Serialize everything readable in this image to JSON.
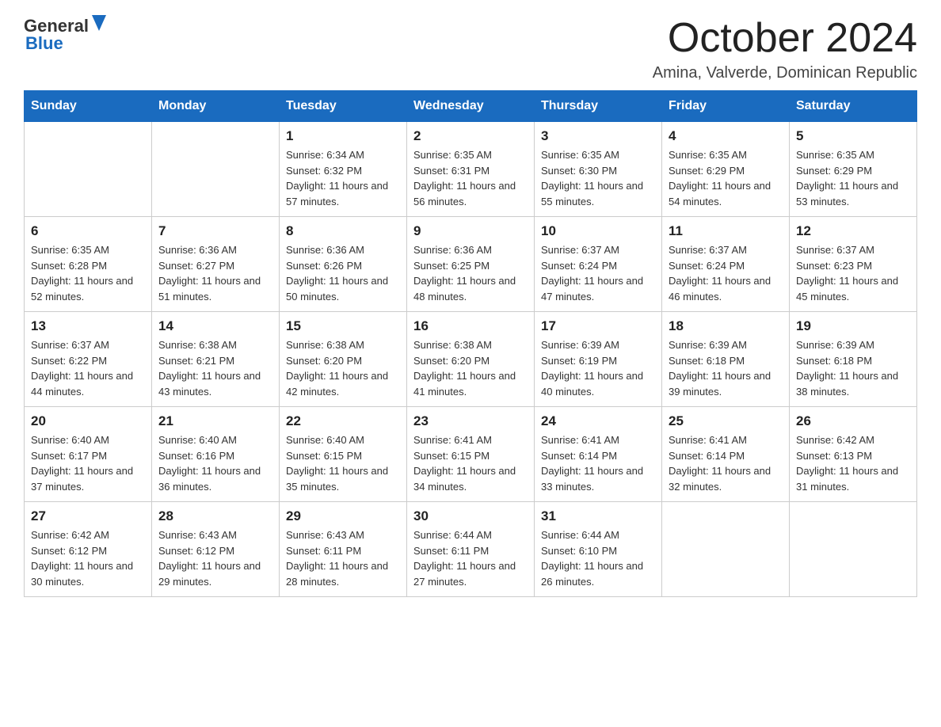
{
  "logo": {
    "text_general": "General",
    "text_blue": "Blue"
  },
  "header": {
    "title": "October 2024",
    "subtitle": "Amina, Valverde, Dominican Republic"
  },
  "days_of_week": [
    "Sunday",
    "Monday",
    "Tuesday",
    "Wednesday",
    "Thursday",
    "Friday",
    "Saturday"
  ],
  "weeks": [
    [
      {
        "day": "",
        "sunrise": "",
        "sunset": "",
        "daylight": ""
      },
      {
        "day": "",
        "sunrise": "",
        "sunset": "",
        "daylight": ""
      },
      {
        "day": "1",
        "sunrise": "Sunrise: 6:34 AM",
        "sunset": "Sunset: 6:32 PM",
        "daylight": "Daylight: 11 hours and 57 minutes."
      },
      {
        "day": "2",
        "sunrise": "Sunrise: 6:35 AM",
        "sunset": "Sunset: 6:31 PM",
        "daylight": "Daylight: 11 hours and 56 minutes."
      },
      {
        "day": "3",
        "sunrise": "Sunrise: 6:35 AM",
        "sunset": "Sunset: 6:30 PM",
        "daylight": "Daylight: 11 hours and 55 minutes."
      },
      {
        "day": "4",
        "sunrise": "Sunrise: 6:35 AM",
        "sunset": "Sunset: 6:29 PM",
        "daylight": "Daylight: 11 hours and 54 minutes."
      },
      {
        "day": "5",
        "sunrise": "Sunrise: 6:35 AM",
        "sunset": "Sunset: 6:29 PM",
        "daylight": "Daylight: 11 hours and 53 minutes."
      }
    ],
    [
      {
        "day": "6",
        "sunrise": "Sunrise: 6:35 AM",
        "sunset": "Sunset: 6:28 PM",
        "daylight": "Daylight: 11 hours and 52 minutes."
      },
      {
        "day": "7",
        "sunrise": "Sunrise: 6:36 AM",
        "sunset": "Sunset: 6:27 PM",
        "daylight": "Daylight: 11 hours and 51 minutes."
      },
      {
        "day": "8",
        "sunrise": "Sunrise: 6:36 AM",
        "sunset": "Sunset: 6:26 PM",
        "daylight": "Daylight: 11 hours and 50 minutes."
      },
      {
        "day": "9",
        "sunrise": "Sunrise: 6:36 AM",
        "sunset": "Sunset: 6:25 PM",
        "daylight": "Daylight: 11 hours and 48 minutes."
      },
      {
        "day": "10",
        "sunrise": "Sunrise: 6:37 AM",
        "sunset": "Sunset: 6:24 PM",
        "daylight": "Daylight: 11 hours and 47 minutes."
      },
      {
        "day": "11",
        "sunrise": "Sunrise: 6:37 AM",
        "sunset": "Sunset: 6:24 PM",
        "daylight": "Daylight: 11 hours and 46 minutes."
      },
      {
        "day": "12",
        "sunrise": "Sunrise: 6:37 AM",
        "sunset": "Sunset: 6:23 PM",
        "daylight": "Daylight: 11 hours and 45 minutes."
      }
    ],
    [
      {
        "day": "13",
        "sunrise": "Sunrise: 6:37 AM",
        "sunset": "Sunset: 6:22 PM",
        "daylight": "Daylight: 11 hours and 44 minutes."
      },
      {
        "day": "14",
        "sunrise": "Sunrise: 6:38 AM",
        "sunset": "Sunset: 6:21 PM",
        "daylight": "Daylight: 11 hours and 43 minutes."
      },
      {
        "day": "15",
        "sunrise": "Sunrise: 6:38 AM",
        "sunset": "Sunset: 6:20 PM",
        "daylight": "Daylight: 11 hours and 42 minutes."
      },
      {
        "day": "16",
        "sunrise": "Sunrise: 6:38 AM",
        "sunset": "Sunset: 6:20 PM",
        "daylight": "Daylight: 11 hours and 41 minutes."
      },
      {
        "day": "17",
        "sunrise": "Sunrise: 6:39 AM",
        "sunset": "Sunset: 6:19 PM",
        "daylight": "Daylight: 11 hours and 40 minutes."
      },
      {
        "day": "18",
        "sunrise": "Sunrise: 6:39 AM",
        "sunset": "Sunset: 6:18 PM",
        "daylight": "Daylight: 11 hours and 39 minutes."
      },
      {
        "day": "19",
        "sunrise": "Sunrise: 6:39 AM",
        "sunset": "Sunset: 6:18 PM",
        "daylight": "Daylight: 11 hours and 38 minutes."
      }
    ],
    [
      {
        "day": "20",
        "sunrise": "Sunrise: 6:40 AM",
        "sunset": "Sunset: 6:17 PM",
        "daylight": "Daylight: 11 hours and 37 minutes."
      },
      {
        "day": "21",
        "sunrise": "Sunrise: 6:40 AM",
        "sunset": "Sunset: 6:16 PM",
        "daylight": "Daylight: 11 hours and 36 minutes."
      },
      {
        "day": "22",
        "sunrise": "Sunrise: 6:40 AM",
        "sunset": "Sunset: 6:15 PM",
        "daylight": "Daylight: 11 hours and 35 minutes."
      },
      {
        "day": "23",
        "sunrise": "Sunrise: 6:41 AM",
        "sunset": "Sunset: 6:15 PM",
        "daylight": "Daylight: 11 hours and 34 minutes."
      },
      {
        "day": "24",
        "sunrise": "Sunrise: 6:41 AM",
        "sunset": "Sunset: 6:14 PM",
        "daylight": "Daylight: 11 hours and 33 minutes."
      },
      {
        "day": "25",
        "sunrise": "Sunrise: 6:41 AM",
        "sunset": "Sunset: 6:14 PM",
        "daylight": "Daylight: 11 hours and 32 minutes."
      },
      {
        "day": "26",
        "sunrise": "Sunrise: 6:42 AM",
        "sunset": "Sunset: 6:13 PM",
        "daylight": "Daylight: 11 hours and 31 minutes."
      }
    ],
    [
      {
        "day": "27",
        "sunrise": "Sunrise: 6:42 AM",
        "sunset": "Sunset: 6:12 PM",
        "daylight": "Daylight: 11 hours and 30 minutes."
      },
      {
        "day": "28",
        "sunrise": "Sunrise: 6:43 AM",
        "sunset": "Sunset: 6:12 PM",
        "daylight": "Daylight: 11 hours and 29 minutes."
      },
      {
        "day": "29",
        "sunrise": "Sunrise: 6:43 AM",
        "sunset": "Sunset: 6:11 PM",
        "daylight": "Daylight: 11 hours and 28 minutes."
      },
      {
        "day": "30",
        "sunrise": "Sunrise: 6:44 AM",
        "sunset": "Sunset: 6:11 PM",
        "daylight": "Daylight: 11 hours and 27 minutes."
      },
      {
        "day": "31",
        "sunrise": "Sunrise: 6:44 AM",
        "sunset": "Sunset: 6:10 PM",
        "daylight": "Daylight: 11 hours and 26 minutes."
      },
      {
        "day": "",
        "sunrise": "",
        "sunset": "",
        "daylight": ""
      },
      {
        "day": "",
        "sunrise": "",
        "sunset": "",
        "daylight": ""
      }
    ]
  ]
}
